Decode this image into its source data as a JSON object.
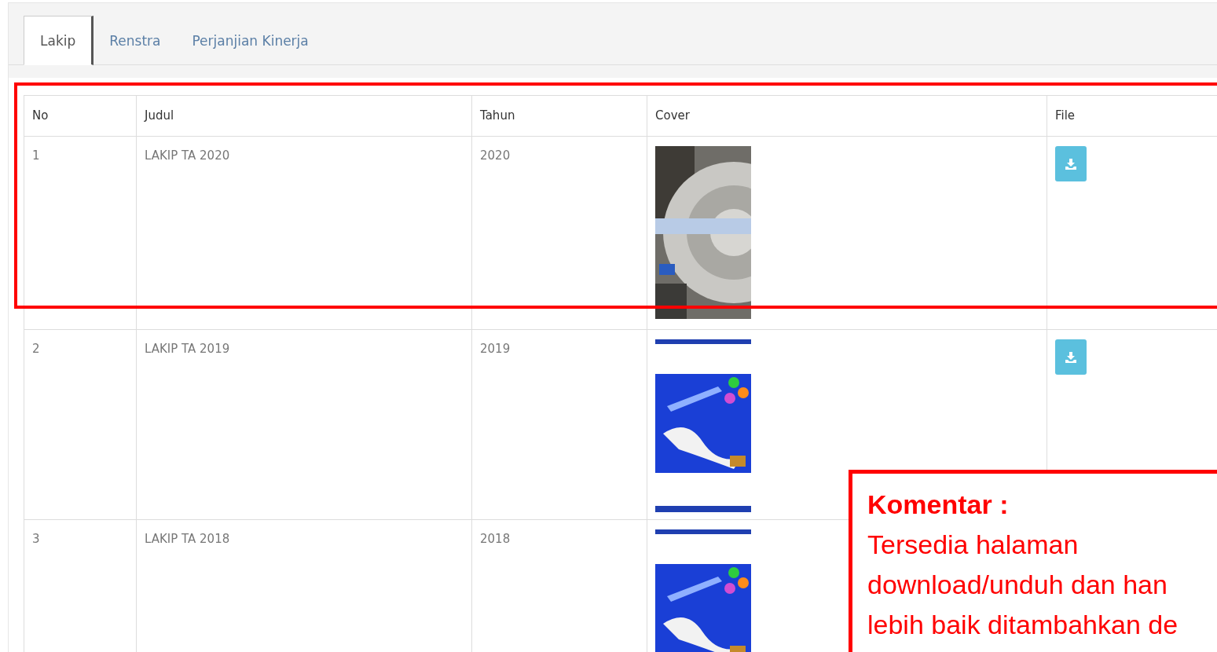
{
  "tabs": [
    {
      "label": "Lakip",
      "selected": true
    },
    {
      "label": "Renstra",
      "selected": false
    },
    {
      "label": "Perjanjian Kinerja",
      "selected": false
    }
  ],
  "table": {
    "columns": [
      "No",
      "Judul",
      "Tahun",
      "Cover",
      "File"
    ],
    "rows": [
      {
        "no": "1",
        "judul": "LAKIP TA 2020",
        "tahun": "2020"
      },
      {
        "no": "2",
        "judul": "LAKIP TA 2019",
        "tahun": "2019"
      },
      {
        "no": "3",
        "judul": "LAKIP TA 2018",
        "tahun": "2018"
      }
    ]
  },
  "comment": {
    "title": "Komentar :",
    "lines": [
      "Tersedia halaman",
      "download/unduh dan han",
      "lebih baik ditambahkan de"
    ]
  }
}
